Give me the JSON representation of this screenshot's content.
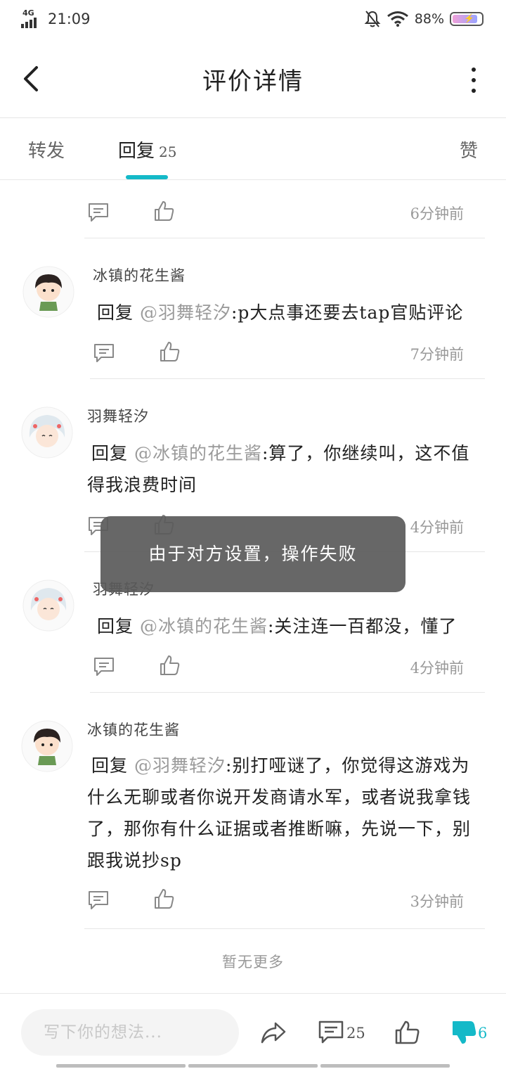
{
  "status_bar": {
    "network": "4G",
    "time": "21:09",
    "battery_percent": "88%",
    "icons": [
      "mute-icon",
      "wifi-icon",
      "battery-charging-icon"
    ]
  },
  "header": {
    "title": "评价详情"
  },
  "tabs": {
    "forward_label": "转发",
    "reply_label": "回复",
    "reply_count": "25",
    "like_label": "赞",
    "active_color": "#14b9c8"
  },
  "top_partial": {
    "time": "6分钟前"
  },
  "comments": [
    {
      "username": "冰镇的花生酱",
      "prefix": "回复 ",
      "mention": "@羽舞轻汐",
      "text": ":p大点事还要去tap官贴评论",
      "time": "7分钟前"
    },
    {
      "username": "羽舞轻汐",
      "prefix": "回复 ",
      "mention": "@冰镇的花生酱",
      "text": ":算了，你继续叫，这不值得我浪费时间",
      "time": "4分钟前"
    },
    {
      "username": "羽舞轻汐",
      "prefix": "回复 ",
      "mention": "@冰镇的花生酱",
      "text": ":关注连一百都没，懂了",
      "time": "4分钟前"
    },
    {
      "username": "冰镇的花生酱",
      "prefix": "回复 ",
      "mention": "@羽舞轻汐",
      "text": ":别打哑谜了，你觉得这游戏为什么无聊或者你说开发商请水军，或者说我拿钱了，那你有什么证据或者推断嘛，先说一下，别跟我说抄sp",
      "time": "3分钟前"
    }
  ],
  "no_more_text": "暂无更多",
  "toast": {
    "text": "由于对方设置，操作失败"
  },
  "bottom_bar": {
    "input_placeholder": "写下你的想法...",
    "comment_count": "25",
    "dislike_count": "6",
    "dislike_color": "#14b9c8"
  }
}
